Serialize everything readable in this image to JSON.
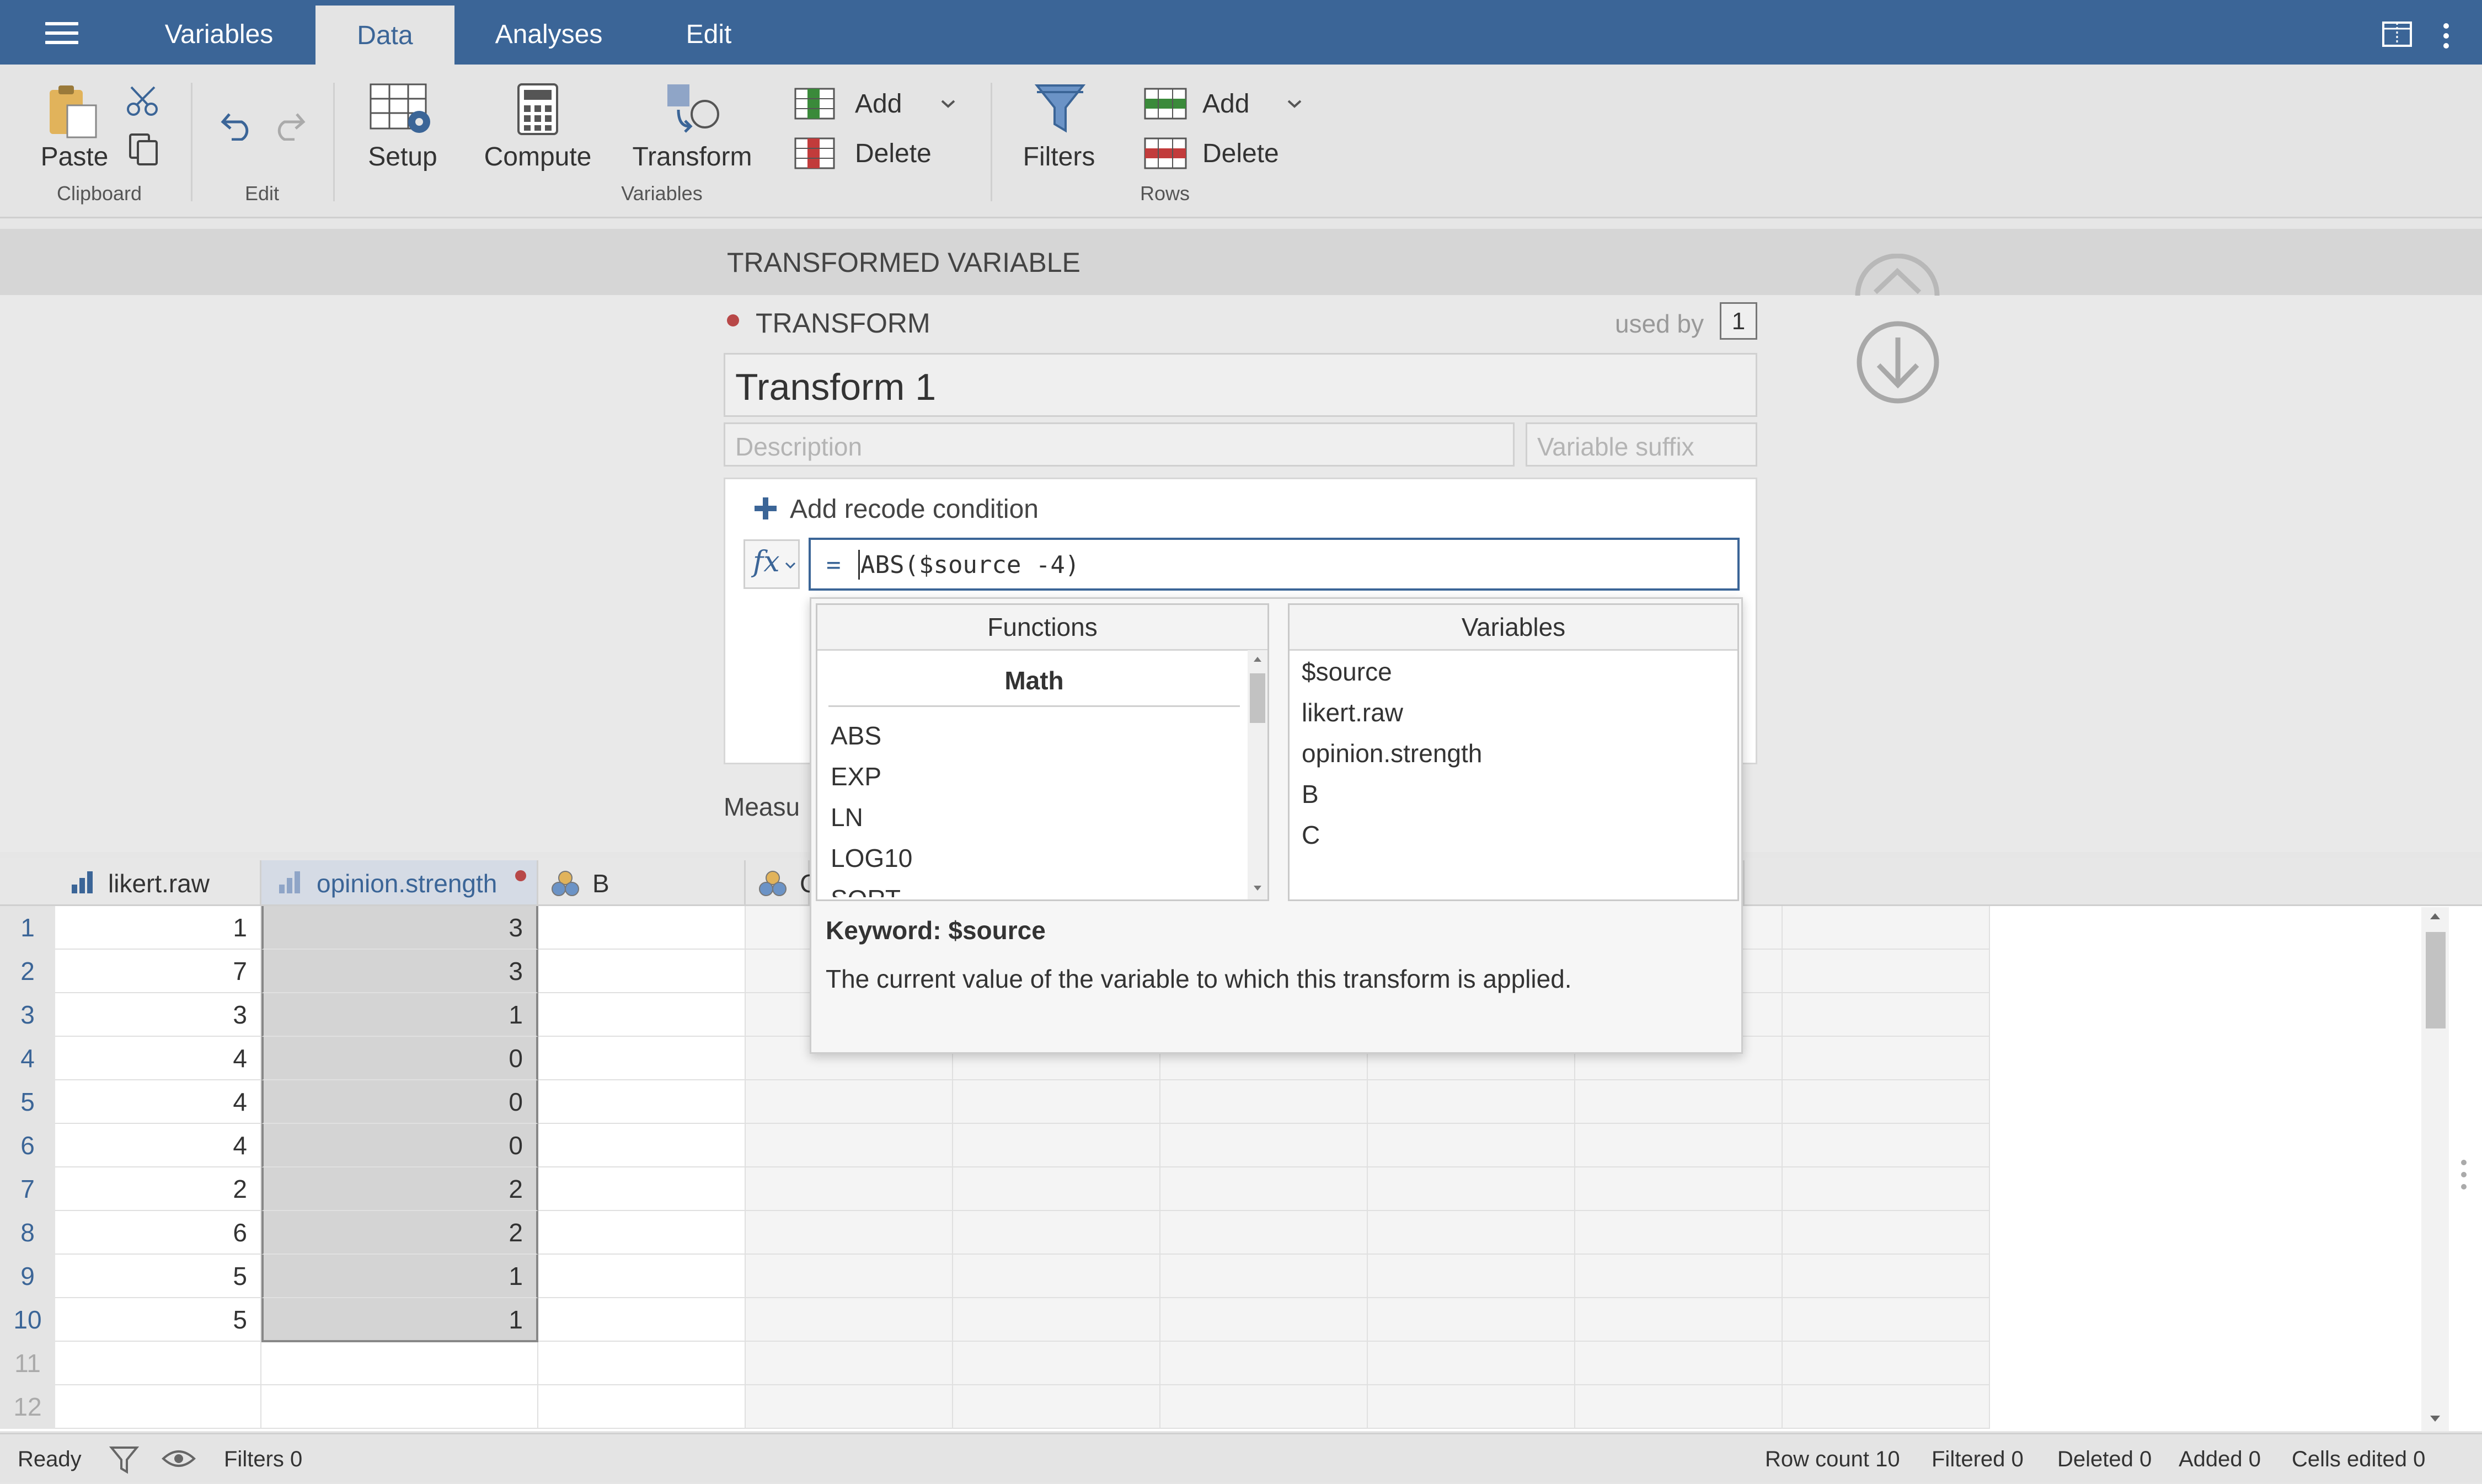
{
  "topbar": {
    "tabs": [
      "Variables",
      "Data",
      "Analyses",
      "Edit"
    ],
    "active_tab": "Data"
  },
  "ribbon": {
    "clipboard": {
      "paste": "Paste",
      "group": "Clipboard"
    },
    "edit": {
      "group": "Edit"
    },
    "variables": {
      "setup": "Setup",
      "compute": "Compute",
      "transform": "Transform",
      "add": "Add",
      "delete": "Delete",
      "group": "Variables"
    },
    "rows": {
      "filters": "Filters",
      "add": "Add",
      "delete": "Delete",
      "group": "Rows"
    }
  },
  "panel": {
    "header_title": "TRANSFORMED VARIABLE",
    "section_label": "TRANSFORM",
    "used_by_label": "used by",
    "used_by_count": "1",
    "name_value": "Transform 1",
    "description_placeholder": "Description",
    "suffix_placeholder": "Variable suffix",
    "add_condition": "Add recode condition",
    "fx_label": "fx",
    "formula_eq": "=",
    "formula": "ABS($source -4)",
    "measure_label": "Measu"
  },
  "dropdown": {
    "functions_header": "Functions",
    "category": "Math",
    "functions": [
      "ABS",
      "EXP",
      "LN",
      "LOG10",
      "SQRT"
    ],
    "variables_header": "Variables",
    "variables": [
      "$source",
      "likert.raw",
      "opinion.strength",
      "B",
      "C"
    ],
    "keyword_title": "Keyword: $source",
    "keyword_desc": "The current value of the variable to which this transform is applied."
  },
  "grid": {
    "columns": [
      "likert.raw",
      "opinion.strength",
      "B",
      "C"
    ],
    "row_numbers": [
      "1",
      "2",
      "3",
      "4",
      "5",
      "6",
      "7",
      "8",
      "9",
      "10",
      "11",
      "12"
    ],
    "likert_raw": [
      "1",
      "7",
      "3",
      "4",
      "4",
      "4",
      "2",
      "6",
      "5",
      "5"
    ],
    "opinion_strength": [
      "3",
      "3",
      "1",
      "0",
      "0",
      "0",
      "2",
      "2",
      "1",
      "1"
    ]
  },
  "status": {
    "ready": "Ready",
    "filters": "Filters 0",
    "row_count": "Row count 10",
    "filtered": "Filtered 0",
    "deleted": "Deleted 0",
    "added": "Added 0",
    "cells_edited": "Cells edited 0"
  },
  "colors": {
    "accent": "#3b6597",
    "selected_col": "#d4d4d4",
    "dot": "#b84848"
  }
}
